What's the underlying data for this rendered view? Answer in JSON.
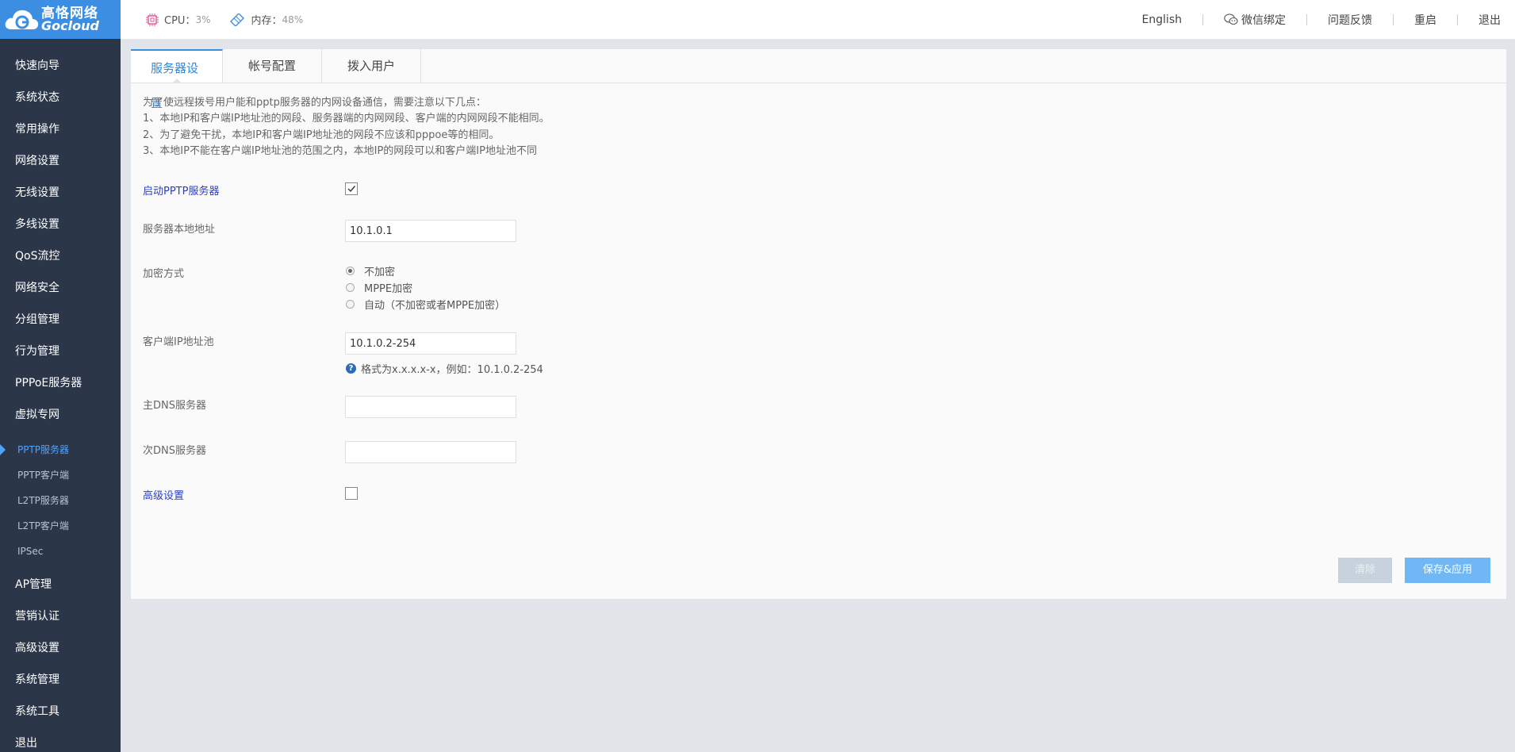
{
  "logo": {
    "cn": "高恪网络",
    "en": "Gocloud"
  },
  "topbar": {
    "cpu_label": "CPU：",
    "cpu_value": "3%",
    "mem_label": "内存：",
    "mem_value": "48%",
    "language": "English",
    "wechat": "微信绑定",
    "feedback": "问题反馈",
    "restart": "重启",
    "logout": "退出"
  },
  "sidebar": {
    "items_top": [
      "快速向导",
      "系统状态",
      "常用操作",
      "网络设置",
      "无线设置",
      "多线设置",
      "QoS流控",
      "网络安全",
      "分组管理",
      "行为管理",
      "PPPoE服务器",
      "虚拟专网"
    ],
    "sub_items": [
      "PPTP服务器",
      "PPTP客户端",
      "L2TP服务器",
      "L2TP客户端",
      "IPSec"
    ],
    "items_bottom": [
      "AP管理",
      "营销认证",
      "高级设置",
      "系统管理",
      "系统工具",
      "退出"
    ]
  },
  "tabs": [
    "服务器设置",
    "帐号配置",
    "拨入用户"
  ],
  "notes": [
    "为了使远程拨号用户能和pptp服务器的内网设备通信，需要注意以下几点：",
    "1、本地IP和客户端IP地址池的网段、服务器端的内网网段、客户端的内网网段不能相同。",
    "2、为了避免干扰，本地IP和客户端IP地址池的网段不应该和pppoe等的相同。",
    "3、本地IP不能在客户端IP地址池的范围之内，本地IP的网段可以和客户端IP地址池不同"
  ],
  "form": {
    "enable_label": "启动PPTP服务器",
    "enable_checked": true,
    "local_addr_label": "服务器本地地址",
    "local_addr_value": "10.1.0.1",
    "encrypt_label": "加密方式",
    "encrypt_options": [
      "不加密",
      "MPPE加密",
      "自动（不加密或者MPPE加密）"
    ],
    "encrypt_selected": "不加密",
    "pool_label": "客户端IP地址池",
    "pool_value": "10.1.0.2-254",
    "pool_hint": "格式为x.x.x.x-x，例如：10.1.0.2-254",
    "dns1_label": "主DNS服务器",
    "dns1_value": "",
    "dns2_label": "次DNS服务器",
    "dns2_value": "",
    "advanced_label": "高级设置",
    "advanced_checked": false
  },
  "buttons": {
    "clear": "清除",
    "save": "保存&应用"
  },
  "colors": {
    "accent": "#3c8ee3",
    "sidebar_bg": "#2b3649",
    "active_sub": "#4ea3ff",
    "form_blue": "#2a3ec9"
  },
  "icons": [
    "cloud-logo-icon",
    "cpu-chip-icon",
    "memory-icon",
    "wechat-icon",
    "help-icon",
    "checkmark-icon"
  ]
}
